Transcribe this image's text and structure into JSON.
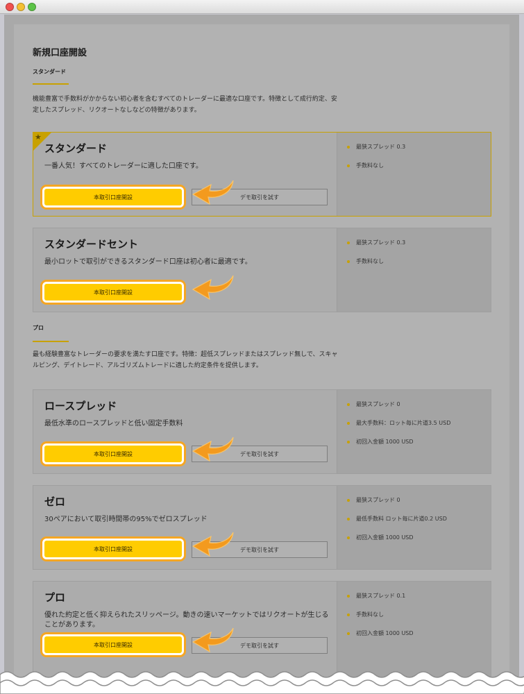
{
  "page": {
    "title": "新規口座開設"
  },
  "sections": [
    {
      "label": "スタンダード",
      "description": "機能豊富で手数料がかからない初心者を含むすべてのトレーダーに最適な口座です。特徴として成行約定、安定したスプレッド、リクオートなしなどの特徴があります。"
    },
    {
      "label": "プロ",
      "description": "最も経験豊富なトレーダーの要求を満たす口座です。特徴：超低スプレッドまたはスプレッド無しで、スキャルピング、デイトレード、アルゴリズムトレードに適した約定条件を提供します。"
    }
  ],
  "accounts": [
    {
      "name": "スタンダード",
      "description": "一番人気！すべてのトレーダーに適した口座です。",
      "open_label": "本取引口座開設",
      "demo_label": "デモ取引を試す",
      "features": [
        "最狭スプレッド 0.3",
        "手数料なし"
      ]
    },
    {
      "name": "スタンダードセント",
      "description": "最小ロットで取引ができるスタンダード口座は初心者に最適です。",
      "open_label": "本取引口座開設",
      "features": [
        "最狭スプレッド 0.3",
        "手数料なし"
      ]
    },
    {
      "name": "ロースプレッド",
      "description": "最低水準のロースプレッドと低い固定手数料",
      "open_label": "本取引口座開設",
      "demo_label": "デモ取引を試す",
      "features": [
        "最狭スプレッド 0",
        "最大手数料：ロット毎に片道3.5 USD",
        "初回入金額 1000 USD"
      ]
    },
    {
      "name": "ゼロ",
      "description": "30ペアにおいて取引時間帯の95%でゼロスプレッド",
      "open_label": "本取引口座開設",
      "demo_label": "デモ取引を試す",
      "features": [
        "最狭スプレッド 0",
        "最低手数料 ロット毎に片道0.2 USD",
        "初回入金額 1000 USD"
      ]
    },
    {
      "name": "プロ",
      "description": "優れた約定と低く抑えられたスリッページ。動きの速いマーケットではリクオートが生じることがあります。",
      "open_label": "本取引口座開設",
      "demo_label": "デモ取引を試す",
      "features": [
        "最狭スプレッド 0.1",
        "手数料なし",
        "初回入金額 1000 USD"
      ]
    }
  ],
  "colors": {
    "accent": "#c8a100",
    "button": "#ffcc00",
    "highlight": "#f5a623"
  }
}
